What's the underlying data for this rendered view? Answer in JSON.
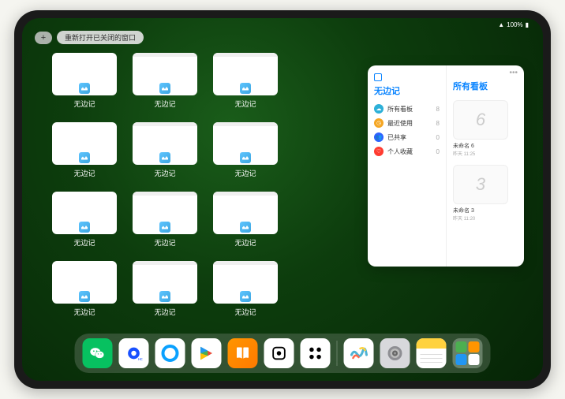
{
  "status": {
    "signal": "􀙇",
    "battery": "100%"
  },
  "topbar": {
    "plus": "+",
    "reopen_label": "重新打开已关闭的窗口"
  },
  "app_window_label": "无边记",
  "windows": [
    {
      "style": "blank"
    },
    {
      "style": "grid-content"
    },
    {
      "style": "grid-content"
    },
    {
      "style": "blank"
    },
    {
      "style": "grid-content"
    },
    {
      "style": "grid-content"
    },
    {
      "style": "blank"
    },
    {
      "style": "grid-content"
    },
    {
      "style": "grid-content"
    },
    {
      "style": "blank"
    },
    {
      "style": "grid-content"
    },
    {
      "style": "grid-content"
    }
  ],
  "sidebar": {
    "title": "无边记",
    "items": [
      {
        "icon_color": "#2db0d8",
        "glyph": "☁",
        "label": "所有看板",
        "count": 8
      },
      {
        "icon_color": "#f5a623",
        "glyph": "◷",
        "label": "最近使用",
        "count": 8
      },
      {
        "icon_color": "#2e62ff",
        "glyph": "👥",
        "label": "已共享",
        "count": 0
      },
      {
        "icon_color": "#ff3b30",
        "glyph": "♡",
        "label": "个人收藏",
        "count": 0
      }
    ],
    "right_title": "所有看板",
    "boards": [
      {
        "sketch": "6",
        "label": "未命名 6",
        "sub": "昨天 11:25"
      },
      {
        "sketch": "3",
        "label": "未命名 3",
        "sub": "昨天 11:20"
      }
    ],
    "more": "•••"
  },
  "dock": {
    "apps": [
      {
        "name": "wechat",
        "bg": "#07c160",
        "glyph_color": "#fff"
      },
      {
        "name": "quark-blue",
        "bg": "#fff",
        "glyph_color": "#1850ff"
      },
      {
        "name": "qq-browser",
        "bg": "#fff",
        "glyph_color": "#0aa1ff"
      },
      {
        "name": "play",
        "bg": "#fff"
      },
      {
        "name": "books",
        "bg": "linear-gradient(135deg,#ff9500,#ff7a00)"
      },
      {
        "name": "dice",
        "bg": "#fff",
        "glyph_color": "#000"
      },
      {
        "name": "connect",
        "bg": "#fff",
        "glyph_color": "#000"
      }
    ],
    "recent": [
      {
        "name": "freeform",
        "bg": "#fff"
      },
      {
        "name": "settings",
        "bg": "#8e8e93"
      },
      {
        "name": "notes",
        "bg": "#fff"
      }
    ]
  }
}
